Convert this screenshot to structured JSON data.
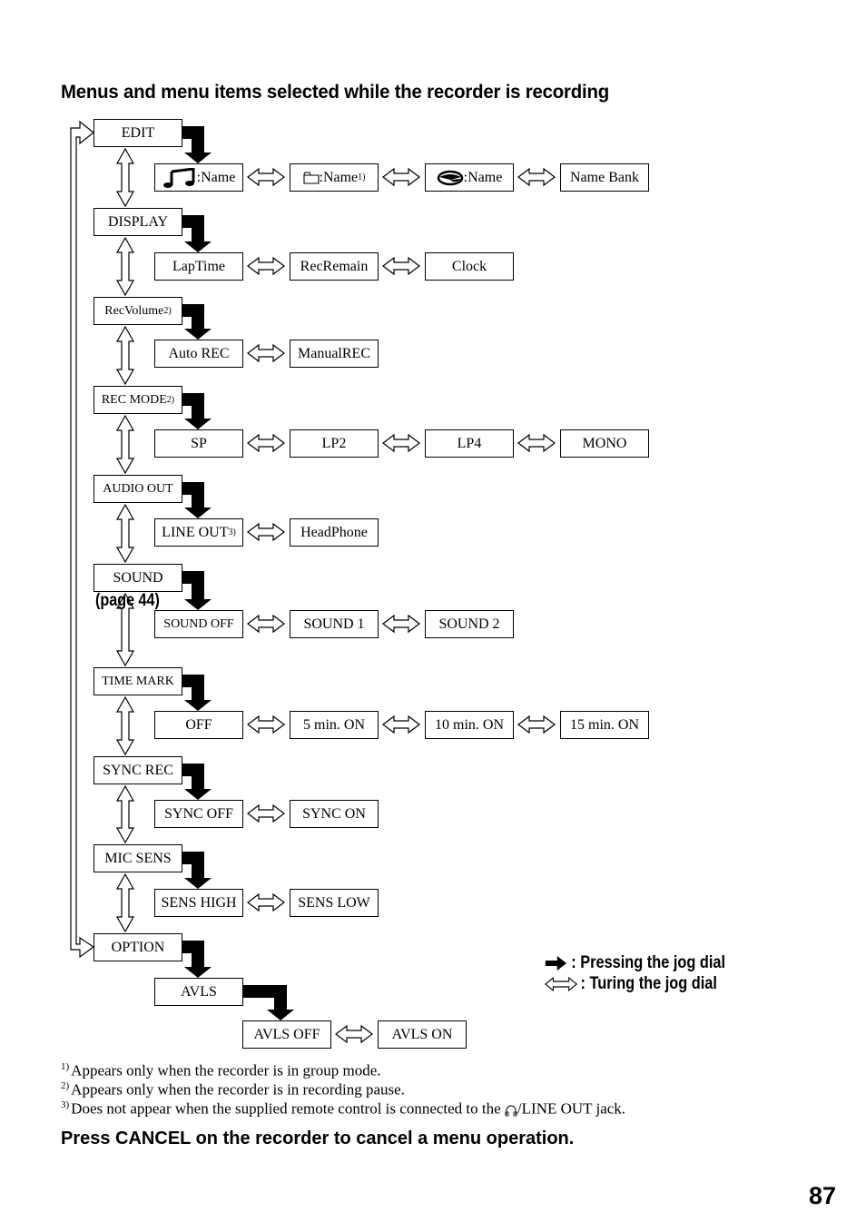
{
  "title": "Menus and menu items selected while the recorder is recording",
  "menus": [
    {
      "label": "EDIT",
      "sup": "",
      "items": [
        {
          "icon": "music-note-icon",
          "label": ":Name",
          "sup": ""
        },
        {
          "icon": "folder-icon",
          "label": ":Name",
          "sup": "1)"
        },
        {
          "icon": "disc-icon",
          "label": ":Name",
          "sup": ""
        },
        {
          "icon": "",
          "label": "Name Bank",
          "sup": ""
        }
      ]
    },
    {
      "label": "DISPLAY",
      "sup": "",
      "items": [
        {
          "label": "LapTime",
          "sup": ""
        },
        {
          "label": "RecRemain",
          "sup": ""
        },
        {
          "label": "Clock",
          "sup": ""
        }
      ]
    },
    {
      "label": "RecVolume",
      "sup": "2)",
      "items": [
        {
          "label": "Auto REC",
          "sup": ""
        },
        {
          "label": "ManualREC",
          "sup": ""
        }
      ]
    },
    {
      "label": "REC MODE",
      "sup": "2)",
      "items": [
        {
          "label": "SP",
          "sup": ""
        },
        {
          "label": "LP2",
          "sup": ""
        },
        {
          "label": "LP4",
          "sup": ""
        },
        {
          "label": "MONO",
          "sup": ""
        }
      ]
    },
    {
      "label": "AUDIO OUT",
      "sup": "",
      "items": [
        {
          "label": "LINE OUT",
          "sup": "3)"
        },
        {
          "label": "HeadPhone",
          "sup": ""
        }
      ]
    },
    {
      "label": "SOUND",
      "sup": "",
      "page_ref": "(page 44)",
      "items": [
        {
          "label": "SOUND OFF",
          "sup": ""
        },
        {
          "label": "SOUND 1",
          "sup": ""
        },
        {
          "label": "SOUND 2",
          "sup": ""
        }
      ]
    },
    {
      "label": "TIME MARK",
      "sup": "",
      "items": [
        {
          "label": "OFF",
          "sup": ""
        },
        {
          "label": "5 min. ON",
          "sup": ""
        },
        {
          "label": "10 min. ON",
          "sup": ""
        },
        {
          "label": "15 min. ON",
          "sup": ""
        }
      ]
    },
    {
      "label": "SYNC REC",
      "sup": "",
      "items": [
        {
          "label": "SYNC OFF",
          "sup": ""
        },
        {
          "label": "SYNC ON",
          "sup": ""
        }
      ]
    },
    {
      "label": "MIC SENS",
      "sup": "",
      "items": [
        {
          "label": "SENS HIGH",
          "sup": ""
        },
        {
          "label": "SENS LOW",
          "sup": ""
        }
      ]
    },
    {
      "label": "OPTION",
      "sup": "",
      "items": [
        {
          "label": "AVLS",
          "sup": ""
        }
      ],
      "sub_items": [
        {
          "label": "AVLS OFF",
          "sup": ""
        },
        {
          "label": "AVLS ON",
          "sup": ""
        }
      ]
    }
  ],
  "legend": {
    "press": ": Pressing the jog dial",
    "turn": ": Turing the jog dial"
  },
  "footnotes": [
    {
      "mark": "1)",
      "text": "Appears only when the recorder is in group mode."
    },
    {
      "mark": "2)",
      "text": "Appears only when the recorder is in recording pause."
    },
    {
      "mark": "3)",
      "text_before": "Does not appear when the supplied remote control is connected to the ",
      "icon": "headphones-icon",
      "text_after": "/LINE OUT jack."
    }
  ],
  "cancel_note": "Press CANCEL on the recorder to cancel a menu operation.",
  "page_number": "87"
}
